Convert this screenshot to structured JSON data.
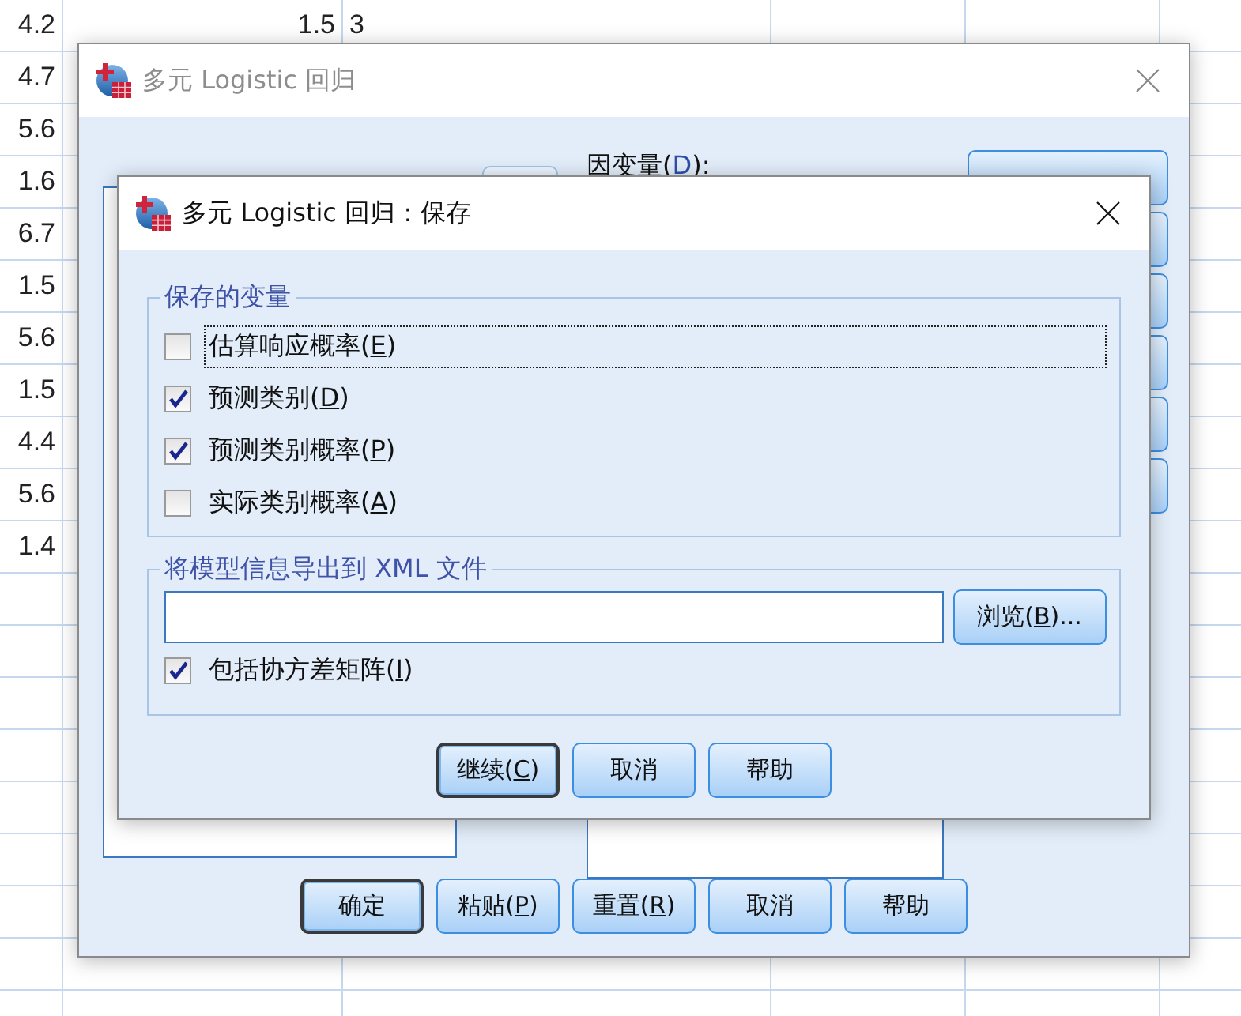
{
  "spreadsheet": {
    "rows": [
      {
        "cells": [
          "4.2",
          "1.5",
          "3"
        ]
      },
      {
        "cells": [
          "4.7"
        ]
      },
      {
        "cells": [
          "5.6"
        ]
      },
      {
        "cells": [
          "1.6"
        ]
      },
      {
        "cells": [
          "6.7"
        ]
      },
      {
        "cells": [
          "1.5"
        ]
      },
      {
        "cells": [
          "5.6"
        ]
      },
      {
        "cells": [
          "1.5"
        ]
      },
      {
        "cells": [
          "4.4"
        ]
      },
      {
        "cells": [
          "5.6"
        ]
      },
      {
        "cells": [
          "1.4"
        ]
      }
    ]
  },
  "parent_dialog": {
    "title": "多元 Logistic 回归",
    "active": false,
    "dependent_label": [
      "因变量(",
      "D",
      "):"
    ],
    "buttons": [
      {
        "label": "确定",
        "default": true
      },
      {
        "label": [
          "粘贴(",
          "P",
          ")"
        ],
        "default": false
      },
      {
        "label": [
          "重置(",
          "R",
          ")"
        ],
        "default": false
      },
      {
        "label": "取消",
        "default": false
      },
      {
        "label": "帮助",
        "default": false
      }
    ]
  },
  "save_dialog": {
    "title": "多元 Logistic 回归：保存",
    "active": true,
    "variables_group": {
      "title": "保存的变量",
      "items": [
        {
          "label": [
            "估算响应概率(",
            "E",
            ")"
          ],
          "checked": false,
          "focused": true
        },
        {
          "label": [
            "预测类别(",
            "D",
            ")"
          ],
          "checked": true,
          "focused": false
        },
        {
          "label": [
            "预测类别概率(",
            "P",
            ")"
          ],
          "checked": true,
          "focused": false
        },
        {
          "label": [
            "实际类别概率(",
            "A",
            ")"
          ],
          "checked": false,
          "focused": false
        }
      ]
    },
    "export_group": {
      "title": "将模型信息导出到 XML 文件",
      "browse_button": {
        "label": [
          "浏览(",
          "B",
          ")..."
        ]
      },
      "covariance": {
        "label": [
          "包括协方差矩阵(",
          "I",
          ")"
        ],
        "checked": true,
        "focused": false
      }
    },
    "buttons": [
      {
        "label": [
          "继续(",
          "C",
          ")"
        ],
        "default": true
      },
      {
        "label": "取消",
        "default": false
      },
      {
        "label": "帮助",
        "default": false
      }
    ]
  }
}
